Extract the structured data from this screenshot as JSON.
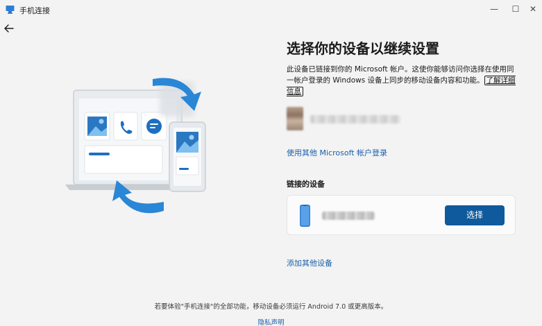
{
  "window": {
    "title": "手机连接",
    "minimize": "—",
    "maximize": "☐",
    "close": "✕"
  },
  "heading": "选择你的设备以继续设置",
  "description": {
    "text": "此设备已链接到你的 Microsoft 帐户。这使你能够访问你选择在使用同一帐户登录的 Windows 设备上同步的移动设备内容和功能。",
    "learn_more": "了解详细信息"
  },
  "account": {
    "other_account_link": "使用其他 Microsoft 帐户登录"
  },
  "linked_devices": {
    "title": "链接的设备",
    "select_button": "选择"
  },
  "add_device_link": "添加其他设备",
  "footer": {
    "note": "若要体验\"手机连接\"的全部功能，移动设备必须运行 Android 7.0 或更高版本。",
    "privacy": "隐私声明"
  },
  "colors": {
    "accent": "#0f5a9c",
    "link": "#1a5fa8",
    "background": "#f3f3f3"
  },
  "icons": {
    "app": "phone-link-icon",
    "back": "back-arrow-icon",
    "device": "phone-icon"
  }
}
